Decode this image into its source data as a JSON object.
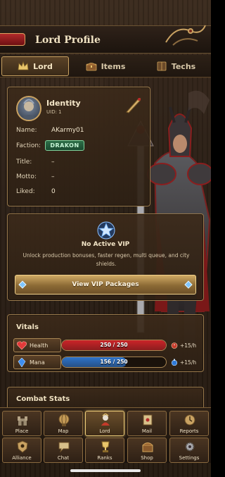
{
  "header": {
    "title": "Lord Profile"
  },
  "tabs": [
    {
      "label": "Lord",
      "icon": "crown-icon",
      "active": true
    },
    {
      "label": "Items",
      "icon": "chest-icon",
      "active": false
    },
    {
      "label": "Techs",
      "icon": "book-icon",
      "active": false
    }
  ],
  "identity": {
    "title": "Identity",
    "uid": "UID: 1",
    "rows": {
      "name_label": "Name:",
      "name_value": "AKarmy01",
      "faction_label": "Faction:",
      "faction_value": "DRAKON",
      "title_label": "Title:",
      "title_value": "–",
      "motto_label": "Motto:",
      "motto_value": "–",
      "liked_label": "Liked:",
      "liked_value": "0"
    },
    "faction_color": "#2e6e48"
  },
  "vip": {
    "status": "No Active VIP",
    "description": "Unlock production bonuses, faster regen, multi queue, and city shields.",
    "button_label": "View VIP Packages"
  },
  "vitals": {
    "title": "Vitals",
    "health": {
      "label": "Health",
      "text": "250 / 250",
      "fraction": 1.0,
      "regen": "+15/h",
      "color": "#d8252b"
    },
    "mana": {
      "label": "Mana",
      "text": "156 / 250",
      "fraction": 0.624,
      "regen": "+15/h",
      "color": "#2f7ad8"
    }
  },
  "combat": {
    "title": "Combat Stats"
  },
  "nav": {
    "row1": [
      {
        "label": "Place",
        "icon": "castle-icon"
      },
      {
        "label": "Map",
        "icon": "globe-icon"
      },
      {
        "label": "Lord",
        "icon": "lord-icon",
        "active": true
      },
      {
        "label": "Mail",
        "icon": "mail-icon"
      },
      {
        "label": "Reports",
        "icon": "scroll-icon"
      }
    ],
    "row2": [
      {
        "label": "Alliance",
        "icon": "alliance-icon"
      },
      {
        "label": "Chat",
        "icon": "chat-icon"
      },
      {
        "label": "Ranks",
        "icon": "trophy-icon"
      },
      {
        "label": "Shop",
        "icon": "shop-icon"
      },
      {
        "label": "Settings",
        "icon": "gear-icon"
      }
    ]
  }
}
